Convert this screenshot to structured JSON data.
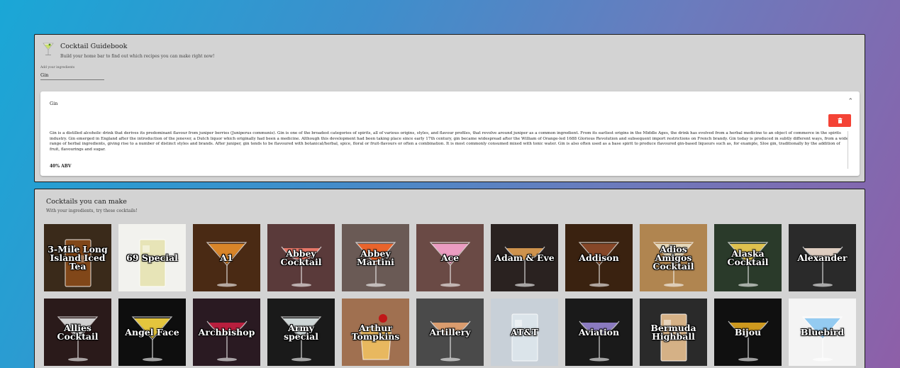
{
  "app": {
    "title": "Cocktail Guidebook",
    "subtitle": "Build your home bar to find out which recipes you can make right now!",
    "icon": "martini-glass-icon"
  },
  "ingredient_input": {
    "label": "Add your ingredients",
    "value": "Gin"
  },
  "ingredient_card": {
    "title": "Gin",
    "description": "Gin is a distilled alcoholic drink that derives its predominant flavour from juniper berries (Juniperus communis). Gin is one of the broadest categories of spirits, all of various origins, styles, and flavour profiles, that revolve around juniper as a common ingredient. From its earliest origins in the Middle Ages, the drink has evolved from a herbal medicine to an object of commerce in the spirits industry. Gin emerged in England after the introduction of the jenever, a Dutch liquor which originally had been a medicine. Although this development had been taking place since early 17th century, gin became widespread after the William of Orange-led 1688 Glorious Revolution and subsequent import restrictions on French brandy. Gin today is produced in subtly different ways, from a wide range of herbal ingredients, giving rise to a number of distinct styles and brands. After juniper, gin tends to be flavoured with botanical/herbal, spice, floral or fruit-flavours or often a combination. It is most commonly consumed mixed with tonic water. Gin is also often used as a base spirit to produce flavoured gin-based liqueurs such as, for example, Sloe gin, traditionally by the addition of fruit, flavourings and sugar.",
    "abv": "40% ABV",
    "delete_color": "#f44336"
  },
  "cocktails_section": {
    "title": "Cocktails you can make",
    "subtitle": "With your ingredients, try these cocktails!"
  },
  "cocktails": [
    {
      "name": "3-Mile Long Island Iced Tea",
      "bg": "#3a2a1a",
      "glass": "highball",
      "liquid": "#8a4a1a"
    },
    {
      "name": "69 Special",
      "bg": "#f2f2ee",
      "glass": "highball",
      "liquid": "#e6e2b0"
    },
    {
      "name": "A1",
      "bg": "#4a2a14",
      "glass": "martini",
      "liquid": "#e08a2a"
    },
    {
      "name": "Abbey Cocktail",
      "bg": "#5a3a3a",
      "glass": "coupe",
      "liquid": "#f07a6a"
    },
    {
      "name": "Abbey Martini",
      "bg": "#6a5a55",
      "glass": "martini",
      "liquid": "#f0652a"
    },
    {
      "name": "Ace",
      "bg": "#6a4a45",
      "glass": "martini",
      "liquid": "#f2a0c8"
    },
    {
      "name": "Adam & Eve",
      "bg": "#2a2220",
      "glass": "coupe",
      "liquid": "#d89a50"
    },
    {
      "name": "Addison",
      "bg": "#3a2210",
      "glass": "martini",
      "liquid": "#8a4a2a"
    },
    {
      "name": "Adios Amigos Cocktail",
      "bg": "#b08550",
      "glass": "martini",
      "liquid": "#e8dcc0"
    },
    {
      "name": "Alaska Cocktail",
      "bg": "#2a3a2a",
      "glass": "martini",
      "liquid": "#e8c850"
    },
    {
      "name": "Alexander",
      "bg": "#2a2a2a",
      "glass": "coupe",
      "liquid": "#e8d6c8"
    },
    {
      "name": "Allies Cocktail",
      "bg": "#2a1a1a",
      "glass": "martini",
      "liquid": "#dadada"
    },
    {
      "name": "Angel Face",
      "bg": "#0e0e0e",
      "glass": "martini",
      "liquid": "#f0d040"
    },
    {
      "name": "Archbishop",
      "bg": "#2a1a22",
      "glass": "coupe",
      "liquid": "#c02040"
    },
    {
      "name": "Army special",
      "bg": "#1a1a1a",
      "glass": "martini",
      "liquid": "#d8e0e0"
    },
    {
      "name": "Arthur Tompkins",
      "bg": "#a07050",
      "glass": "rocks",
      "liquid": "#f0c060"
    },
    {
      "name": "Artillery",
      "bg": "#4a4a4a",
      "glass": "coupe",
      "liquid": "#e0a070"
    },
    {
      "name": "AT&T",
      "bg": "#c8d0d8",
      "glass": "highball",
      "liquid": "#dde6ec"
    },
    {
      "name": "Aviation",
      "bg": "#1a1a1a",
      "glass": "coupe",
      "liquid": "#9080c8"
    },
    {
      "name": "Bermuda Highball",
      "bg": "#2a2a2a",
      "glass": "highball",
      "liquid": "#e8c090"
    },
    {
      "name": "Bijou",
      "bg": "#101010",
      "glass": "coupe",
      "liquid": "#d8a020"
    },
    {
      "name": "Bluebird",
      "bg": "#f4f4f4",
      "glass": "martini",
      "liquid": "#8ec8f0"
    }
  ]
}
